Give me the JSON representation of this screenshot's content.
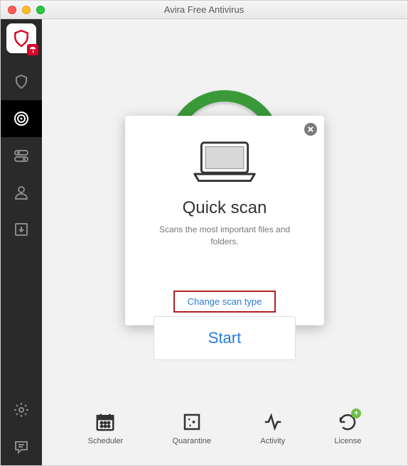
{
  "window": {
    "title": "Avira Free Antivirus"
  },
  "sidebar": {
    "items": [
      {
        "name": "status"
      },
      {
        "name": "scan"
      },
      {
        "name": "modules"
      },
      {
        "name": "profile"
      },
      {
        "name": "update"
      }
    ],
    "bottom": [
      {
        "name": "settings"
      },
      {
        "name": "feedback"
      }
    ]
  },
  "card": {
    "title": "Quick scan",
    "description": "Scans the most important files and folders.",
    "link": "Change scan type"
  },
  "start_button": "Start",
  "tools": [
    {
      "label": "Scheduler"
    },
    {
      "label": "Quarantine"
    },
    {
      "label": "Activity"
    },
    {
      "label": "License"
    }
  ]
}
